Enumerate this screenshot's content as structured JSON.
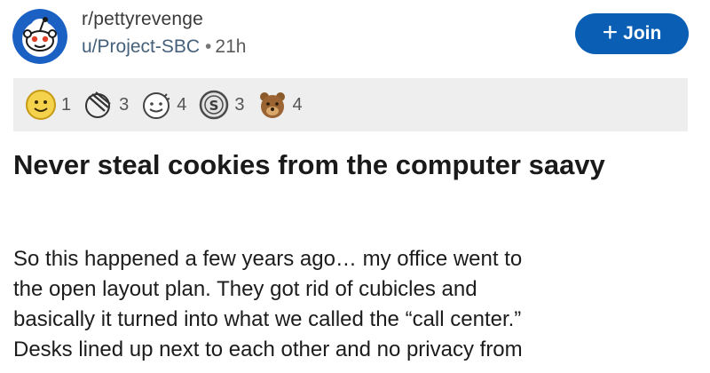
{
  "post": {
    "subreddit": "r/pettyrevenge",
    "author": "u/Project-SBC",
    "separator": "•",
    "age": "21h",
    "join_label": "Join",
    "join_icon": "plus-icon",
    "title": "Never steal cookies from the computer saavy",
    "body_lines": [
      "So this happened a few years ago… my office went to",
      "the open layout plan. They got rid of cubicles and",
      "basically it turned into what we called the “call center.”",
      "Desks lined up next to each other and no privacy from"
    ]
  },
  "awards": [
    {
      "icon": "helpful-award-icon",
      "count": "1"
    },
    {
      "icon": "facepalm-award-icon",
      "count": "3"
    },
    {
      "icon": "wholesome-award-icon",
      "count": "4"
    },
    {
      "icon": "silver-award-icon",
      "count": "3"
    },
    {
      "icon": "bear-award-icon",
      "count": "4"
    }
  ],
  "colors": {
    "join_button": "#0a5fb4",
    "awards_background": "#eeeeee",
    "author_link": "#44607a"
  }
}
